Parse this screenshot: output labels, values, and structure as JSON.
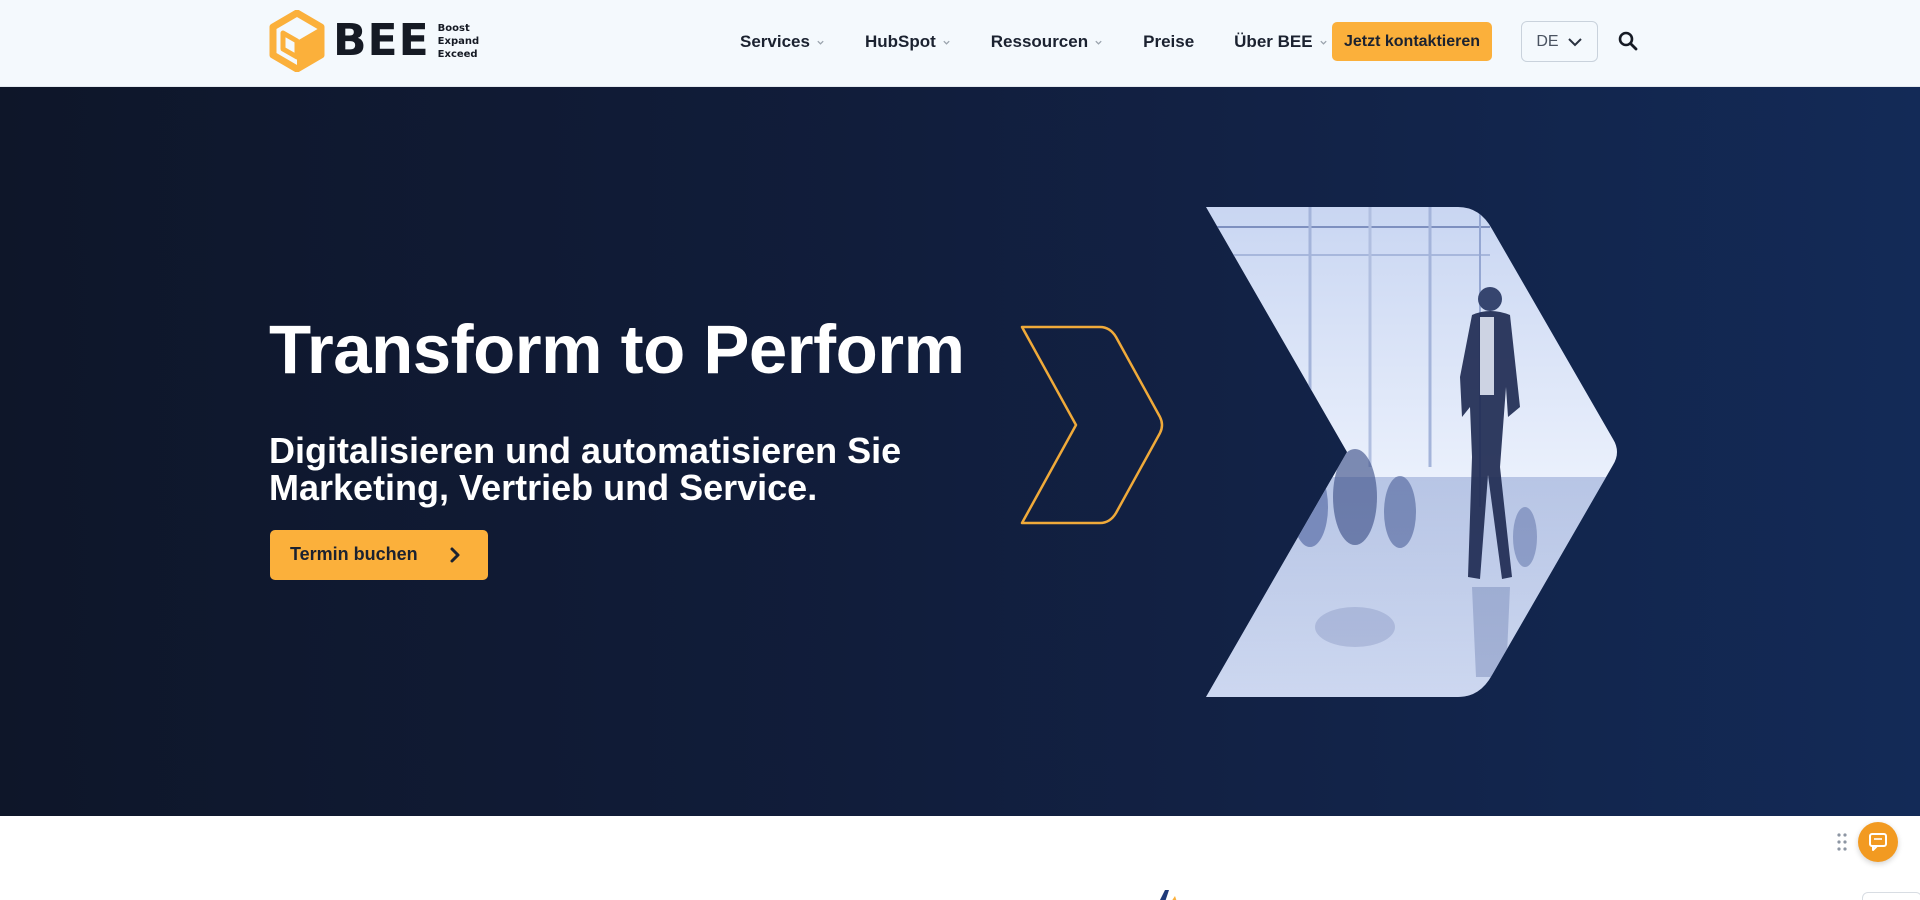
{
  "brand": {
    "name": "BEE",
    "tagline": [
      "Boost",
      "Expand",
      "Exceed"
    ],
    "accent": "#fbb03b",
    "navy": "#132a57"
  },
  "nav": {
    "items": [
      {
        "label": "Services",
        "has_dropdown": true
      },
      {
        "label": "HubSpot",
        "has_dropdown": true
      },
      {
        "label": "Ressourcen",
        "has_dropdown": true
      },
      {
        "label": "Preise",
        "has_dropdown": false
      },
      {
        "label": "Über BEE",
        "has_dropdown": true
      }
    ],
    "cta_label": "Jetzt kontaktieren",
    "language": "DE",
    "icons": {
      "dropdown": "chevron-down-icon",
      "search": "search-icon",
      "lang": "chevron-down-icon"
    }
  },
  "hero": {
    "title": "Transform to Perform",
    "subtitle": "Digitalisieren und automatisieren Sie Marketing, Vertrieb und Service.",
    "button_label": "Termin buchen",
    "button_icon": "chevron-right-icon"
  },
  "widgets": {
    "chat_icon": "chat-bubble-icon",
    "drag_icon": "drag-handle-icon"
  }
}
